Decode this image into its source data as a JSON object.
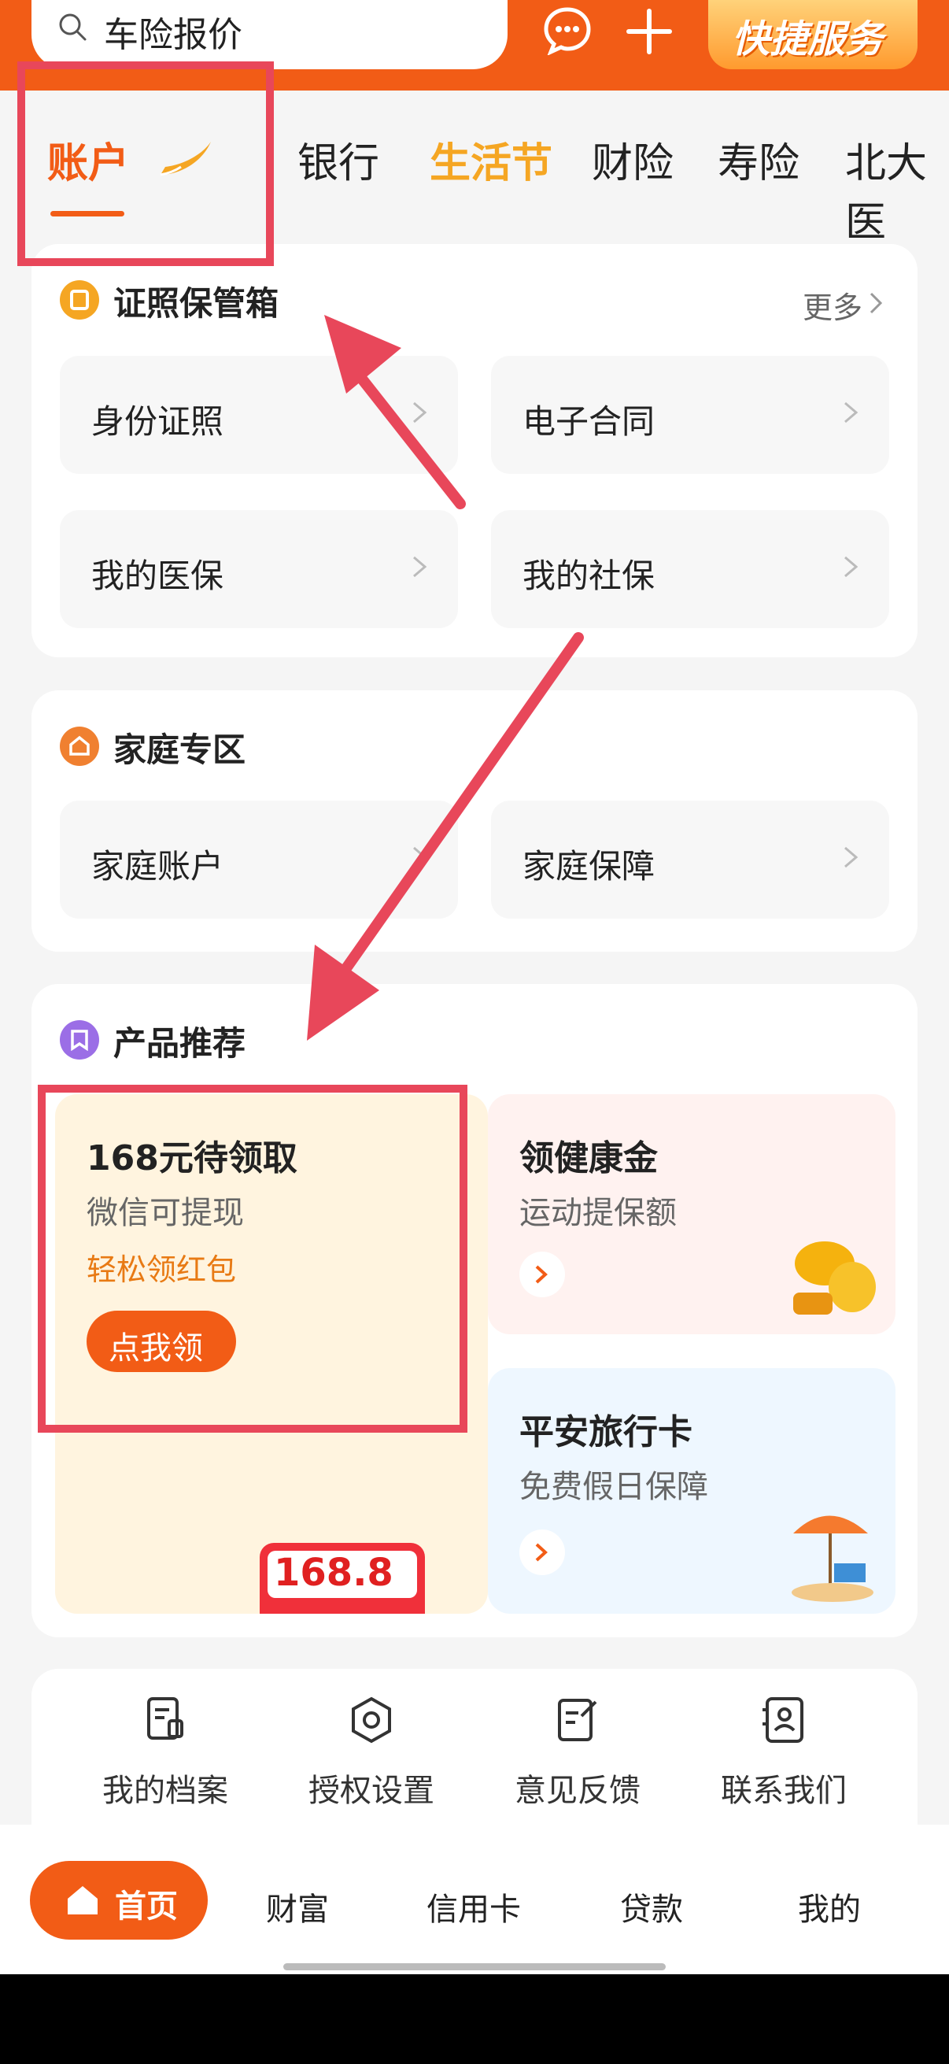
{
  "header": {
    "search_placeholder": "车险报价",
    "quick_service": "快捷服务",
    "icons": [
      "search-icon",
      "chat-icon",
      "plus-icon"
    ]
  },
  "tabs": [
    {
      "label": "账户",
      "active": true
    },
    {
      "label": "银行"
    },
    {
      "label": "生活节",
      "highlight": true
    },
    {
      "label": "财险"
    },
    {
      "label": "寿险"
    },
    {
      "label": "北大医"
    }
  ],
  "documents": {
    "title": "证照保管箱",
    "more": "更多",
    "items": [
      "身份证照",
      "电子合同",
      "我的医保",
      "我的社保"
    ]
  },
  "family": {
    "title": "家庭专区",
    "items": [
      "家庭账户",
      "家庭保障"
    ]
  },
  "products": {
    "title": "产品推荐",
    "promo": {
      "title": "168元待领取",
      "subtitle": "微信可提现",
      "tag": "轻松领红包",
      "button": "点我领",
      "envelope_amount": "168.8"
    },
    "health": {
      "title": "领健康金",
      "subtitle": "运动提保额"
    },
    "travel": {
      "title": "平安旅行卡",
      "subtitle": "免费假日保障"
    }
  },
  "tools": [
    "我的档案",
    "授权设置",
    "意见反馈",
    "联系我们"
  ],
  "bottom_nav": [
    "首页",
    "财富",
    "信用卡",
    "贷款",
    "我的"
  ],
  "colors": {
    "brand": "#f25c16",
    "accent": "#f5a623",
    "annotation": "#e8475a"
  }
}
